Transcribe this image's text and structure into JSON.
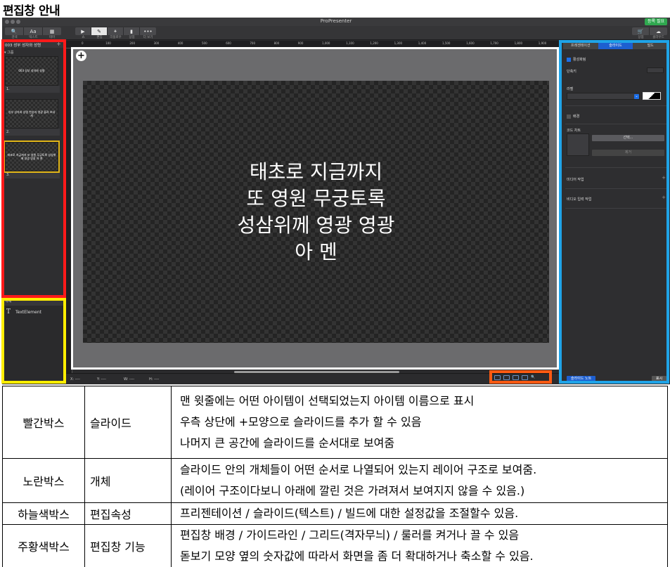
{
  "heading": "편집창 안내",
  "app": {
    "title": "ProPresenter",
    "badge": "등록 필요",
    "toolbar": {
      "left_buttons": [
        "🔍",
        "Aa",
        "▦"
      ],
      "left_labels": [
        "검색",
        "텍스트",
        "테마"
      ],
      "mode_buttons": [
        "▶",
        "✎",
        "⚹",
        "▮",
        "•••"
      ],
      "mode_labels": [
        "쇼",
        "편집",
        "리플로우",
        "상점",
        "더 보기"
      ],
      "right_labels": [
        "상점",
        "클라우드"
      ]
    },
    "left_panel": {
      "doc_title": "003 성부 성자와 성령",
      "add_icon": "+",
      "group_label": "▾ 그룹",
      "slides": [
        {
          "text": "003 성부 성자와 성령",
          "num": "1."
        },
        {
          "text": "성부 성자와 성령 찬송과 영광 돌려 보내세",
          "num": "2."
        },
        {
          "text": "태초로 지금까지 또 영원 무궁토록 성삼위께 영광 영광 아 멘",
          "num": "3."
        }
      ],
      "objects_header": "개체",
      "objects": [
        {
          "icon": "T",
          "label": "TextElement"
        }
      ]
    },
    "ruler_labels": [
      "0",
      "100",
      "200",
      "300",
      "400",
      "500",
      "600",
      "700",
      "800",
      "900",
      "1,000",
      "1,100",
      "1,200",
      "1,300",
      "1,400",
      "1,500",
      "1,600",
      "1,700",
      "1,800",
      "1,900"
    ],
    "slide_lines": [
      "태초로 지금까지",
      "또 영원 무궁토록",
      "성삼위께 영광 영광",
      "아 멘"
    ],
    "status": {
      "x": "X: ----",
      "y": "Y: ----",
      "w": "W: ----",
      "h": "H: ----"
    },
    "right_panel": {
      "tabs": [
        "프레젠테이션",
        "슬라이드",
        "빌드"
      ],
      "active_tab": 1,
      "enabled_label": "활성화됨",
      "shortcut_label": "단축키",
      "label_label": "라벨",
      "background_label": "배경",
      "chord_label": "코드 차트",
      "select_button": "선택...",
      "remove_button": "제거",
      "media_action": "미디어 작업",
      "video_input_action": "비디오 입력 작업",
      "slide_notes_button": "슬라이드 노트",
      "show_button": "표시"
    }
  },
  "highlight_colors": {
    "red": "#ff1a1a",
    "yellow": "#ffee00",
    "sky": "#1fa4e8",
    "orange": "#ff5a12",
    "white": "#ffffff"
  },
  "table": {
    "rows": [
      {
        "box": "빨간박스",
        "name": "슬라이드",
        "lines": [
          "맨 윗줄에는 어떤 아이템이 선택되었는지 아이템 이름으로 표시",
          "우측 상단에 +모양으로 슬라이드를 추가 할 수 있음",
          "나머지 큰 공간에 슬라이드를 순서대로 보여줌"
        ]
      },
      {
        "box": "노란박스",
        "name": "개체",
        "lines": [
          "슬라이드 안의 개체들이 어떤 순서로 나열되어 있는지 레이어 구조로 보여줌.",
          "(레이어 구조이다보니 아래에 깔린 것은 가려져서 보여지지 않을 수 있음.)"
        ]
      },
      {
        "box": "하늘색박스",
        "name": "편집속성",
        "lines": [
          "프리젠테이션 / 슬라이드(텍스트) / 빌드에 대한 설정값을 조절할수 있음."
        ]
      },
      {
        "box": "주황색박스",
        "name": "편집창 기능",
        "lines": [
          "편집창 배경 / 가이드라인 / 그리드(격자무늬) / 룰러를 켜거나 끌 수 있음",
          "돋보기 모양 옆의 숫자값에 따라서 화면을 좀 더 확대하거나 축소할 수 있음."
        ]
      }
    ]
  }
}
